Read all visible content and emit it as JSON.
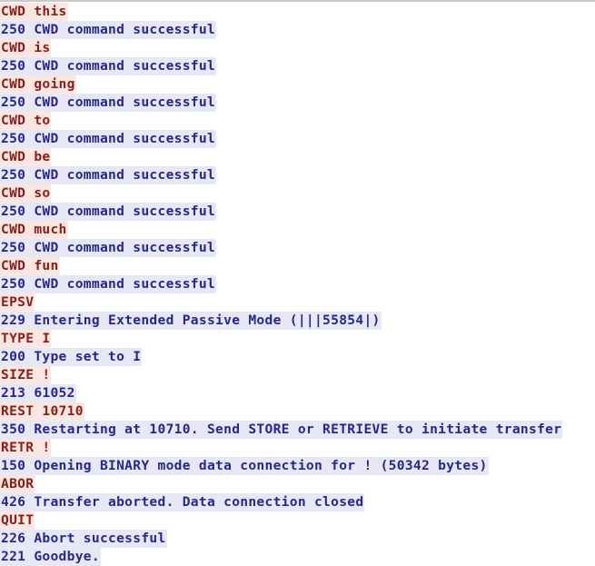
{
  "window": {
    "title": "FTP session transcript",
    "background_color": "#ffffff",
    "top_border_color": "#c9c9c9"
  },
  "legend": {
    "command_text_color": "#8e1b16",
    "command_background_color": "#fae7e1",
    "response_text_color": "#26268f",
    "response_background_color": "#e7e7f6"
  },
  "transcript": {
    "line_count": 30,
    "lines": [
      {
        "kind": "command",
        "text": "CWD this"
      },
      {
        "kind": "response",
        "text": "250 CWD command successful"
      },
      {
        "kind": "command",
        "text": "CWD is"
      },
      {
        "kind": "response",
        "text": "250 CWD command successful"
      },
      {
        "kind": "command",
        "text": "CWD going"
      },
      {
        "kind": "response",
        "text": "250 CWD command successful"
      },
      {
        "kind": "command",
        "text": "CWD to"
      },
      {
        "kind": "response",
        "text": "250 CWD command successful"
      },
      {
        "kind": "command",
        "text": "CWD be"
      },
      {
        "kind": "response",
        "text": "250 CWD command successful"
      },
      {
        "kind": "command",
        "text": "CWD so"
      },
      {
        "kind": "response",
        "text": "250 CWD command successful"
      },
      {
        "kind": "command",
        "text": "CWD much"
      },
      {
        "kind": "response",
        "text": "250 CWD command successful"
      },
      {
        "kind": "command",
        "text": "CWD fun"
      },
      {
        "kind": "response",
        "text": "250 CWD command successful"
      },
      {
        "kind": "command",
        "text": "EPSV"
      },
      {
        "kind": "response",
        "text": "229 Entering Extended Passive Mode (|||55854|)"
      },
      {
        "kind": "command",
        "text": "TYPE I"
      },
      {
        "kind": "response",
        "text": "200 Type set to I"
      },
      {
        "kind": "command",
        "text": "SIZE !"
      },
      {
        "kind": "response",
        "text": "213 61052"
      },
      {
        "kind": "command",
        "text": "REST 10710"
      },
      {
        "kind": "response",
        "text": "350 Restarting at 10710. Send STORE or RETRIEVE to initiate transfer"
      },
      {
        "kind": "command",
        "text": "RETR !"
      },
      {
        "kind": "response",
        "text": "150 Opening BINARY mode data connection for ! (50342 bytes)"
      },
      {
        "kind": "command",
        "text": "ABOR"
      },
      {
        "kind": "response",
        "text": "426 Transfer aborted. Data connection closed"
      },
      {
        "kind": "command",
        "text": "QUIT"
      },
      {
        "kind": "response",
        "text": "226 Abort successful"
      },
      {
        "kind": "response",
        "text": "221 Goodbye."
      }
    ]
  }
}
